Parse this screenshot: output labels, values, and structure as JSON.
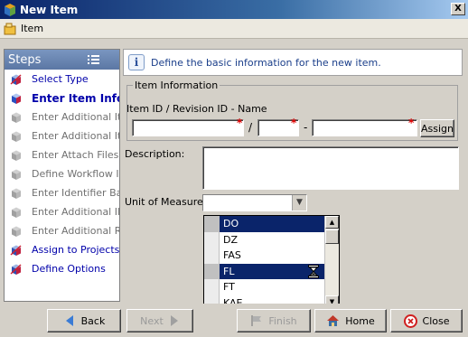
{
  "window": {
    "title": "New Item",
    "close_glyph": "X"
  },
  "header": {
    "item_label": "Item"
  },
  "steps": {
    "title": "Steps",
    "items": [
      {
        "label": "Select Type",
        "state": "done"
      },
      {
        "label": "Enter Item Info",
        "state": "current"
      },
      {
        "label": "Enter Additional Iter",
        "state": "pending"
      },
      {
        "label": "Enter Additional Iter",
        "state": "pending"
      },
      {
        "label": "Enter Attach Files In",
        "state": "pending"
      },
      {
        "label": "Define Workflow Inf",
        "state": "pending"
      },
      {
        "label": "Enter Identifier Basi",
        "state": "pending"
      },
      {
        "label": "Enter Additional ID i",
        "state": "pending"
      },
      {
        "label": "Enter Additional Rev",
        "state": "pending"
      },
      {
        "label": "Assign to Projectss",
        "state": "done"
      },
      {
        "label": "Define Options",
        "state": "done"
      }
    ]
  },
  "info": {
    "text": "Define the basic information for the new item."
  },
  "form": {
    "group_title": "Item Information",
    "id_rev_label": "Item ID / Revision ID - Name",
    "item_id_value": "",
    "revision_id_value": "",
    "name_value": "",
    "slash": "/",
    "dash": "-",
    "required_mark": "*",
    "assign_label": "Assign",
    "description_label": "Description:",
    "description_value": "",
    "uom_label": "Unit of Measure:",
    "uom_value": ""
  },
  "uom_options": [
    "DO",
    "DZ",
    "FAS",
    "FL",
    "FT",
    "KAE"
  ],
  "uom_highlighted": [
    "DO",
    "FL"
  ],
  "buttons": {
    "back": "Back",
    "next": "Next",
    "finish": "Finish",
    "home": "Home",
    "close": "Close"
  }
}
